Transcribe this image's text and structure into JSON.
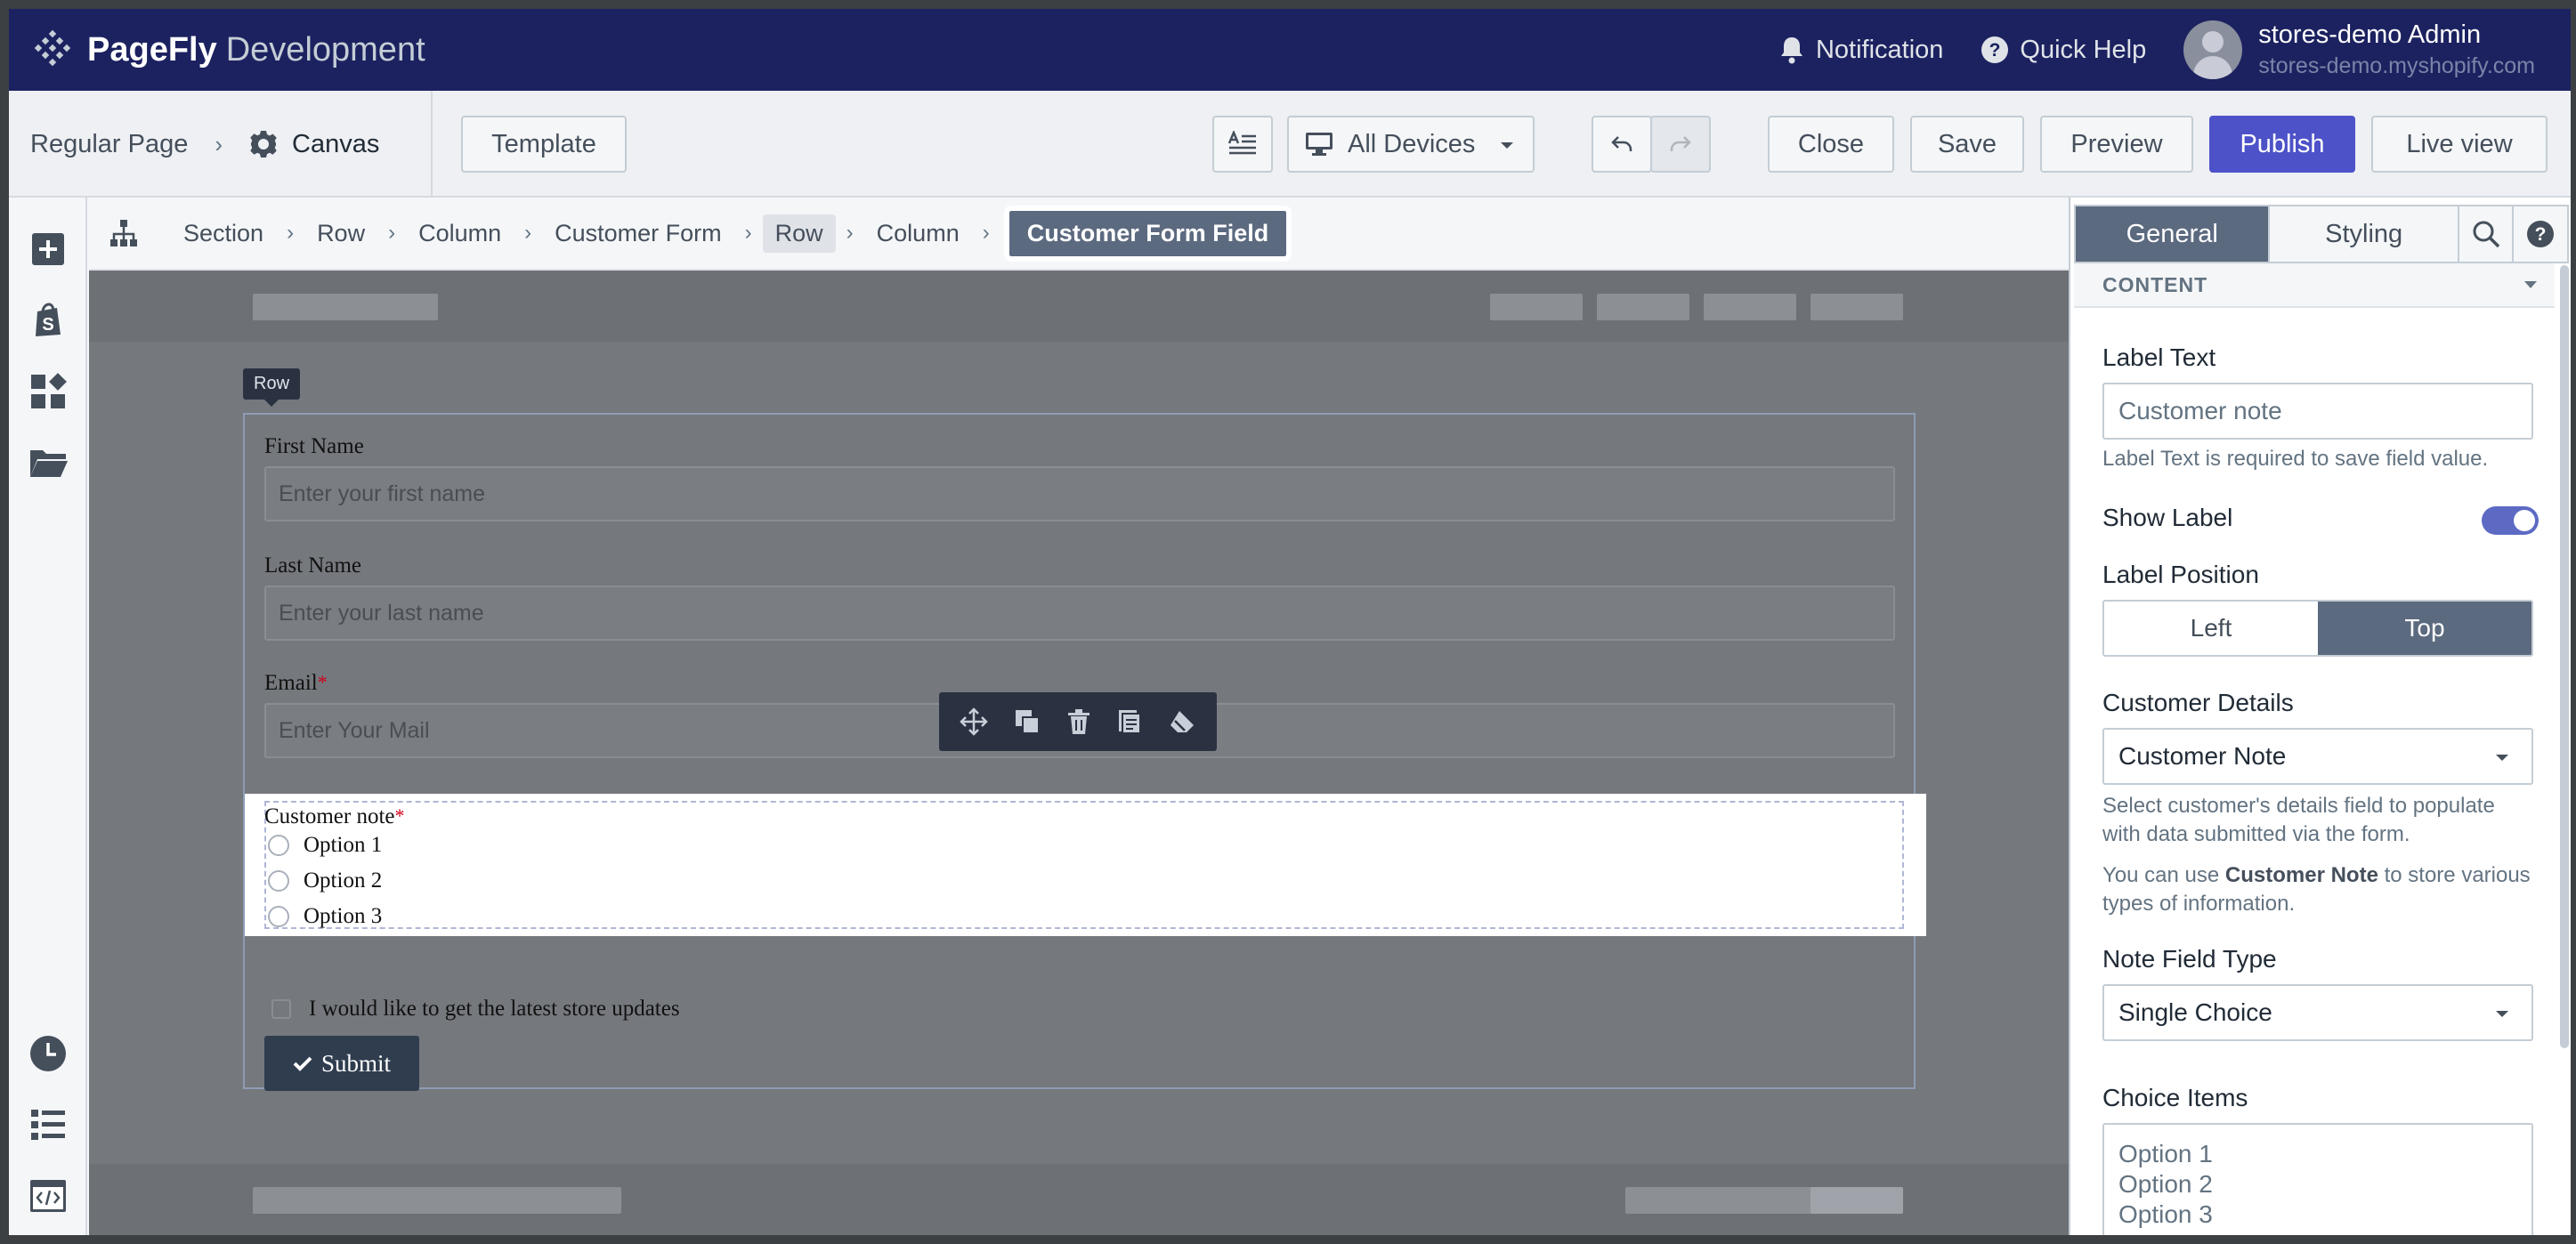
{
  "app": {
    "brand": "PageFly",
    "environment": "Development",
    "notification_label": "Notification",
    "quick_help_label": "Quick Help",
    "user_name": "stores-demo Admin",
    "user_store": "stores-demo.myshopify.com"
  },
  "toolbar": {
    "page_type": "Regular Page",
    "canvas_label": "Canvas",
    "template_label": "Template",
    "device_label": "All Devices",
    "close_label": "Close",
    "save_label": "Save",
    "preview_label": "Preview",
    "publish_label": "Publish",
    "liveview_label": "Live view"
  },
  "breadcrumb": {
    "items": [
      "Section",
      "Row",
      "Column",
      "Customer Form",
      "Row",
      "Column"
    ],
    "active": "Customer Form Field"
  },
  "canvas": {
    "row_tag": "Row",
    "fields": {
      "first_name_label": "First Name",
      "first_name_placeholder": "Enter your first name",
      "last_name_label": "Last Name",
      "last_name_placeholder": "Enter your last name",
      "email_label": "Email",
      "email_placeholder": "Enter Your Mail",
      "required_mark": "*"
    },
    "note": {
      "label": "Customer note",
      "options": [
        "Option 1",
        "Option 2",
        "Option 3"
      ]
    },
    "newsletter_label": "I would like to get the latest store updates",
    "submit_label": "Submit"
  },
  "panel": {
    "tab_general": "General",
    "tab_styling": "Styling",
    "section_title": "CONTENT",
    "label_text_title": "Label Text",
    "label_text_value": "Customer note",
    "label_text_help": "Label Text is required to save field value.",
    "show_label_title": "Show Label",
    "show_label_on": true,
    "label_position_title": "Label Position",
    "position_left": "Left",
    "position_top": "Top",
    "customer_details_title": "Customer Details",
    "customer_details_value": "Customer Note",
    "customer_details_help": "Select customer's details field to populate with data submitted via the form.",
    "help_prefix": "You can use",
    "help_bold": "Customer Note",
    "help_suffix": "to store various types of information.",
    "note_field_type_title": "Note Field Type",
    "note_field_type_value": "Single Choice",
    "choice_items_title": "Choice Items",
    "choice_items": [
      "Option 1",
      "Option 2",
      "Option 3"
    ]
  },
  "colors": {
    "topbar": "#1c2260",
    "publish": "#4d52c8",
    "active_tab": "#5c6a80",
    "toggle": "#5c6ac4"
  }
}
